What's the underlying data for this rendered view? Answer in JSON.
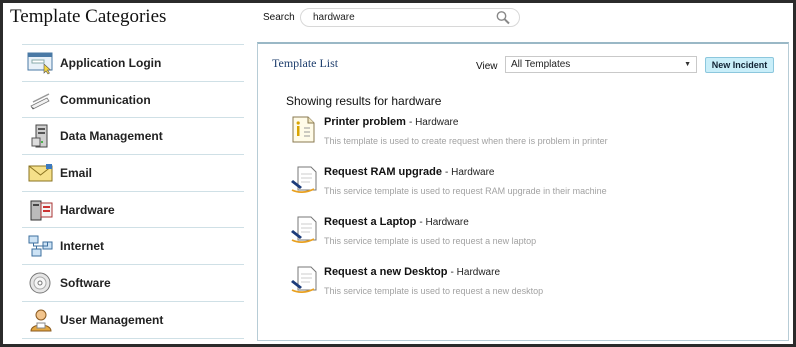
{
  "header": {
    "title": "Template Categories",
    "search_label": "Search",
    "search_value": "hardware"
  },
  "sidebar": {
    "items": [
      {
        "label": "Application Login",
        "icon": "login-window-icon"
      },
      {
        "label": "Communication",
        "icon": "pen-icon"
      },
      {
        "label": "Data Management",
        "icon": "server-icon"
      },
      {
        "label": "Email",
        "icon": "envelope-icon"
      },
      {
        "label": "Hardware",
        "icon": "hardware-icon"
      },
      {
        "label": "Internet",
        "icon": "network-icon"
      },
      {
        "label": "Software",
        "icon": "disc-icon"
      },
      {
        "label": "User Management",
        "icon": "user-icon"
      }
    ]
  },
  "main": {
    "list_title": "Template List",
    "view_label": "View",
    "view_value": "All Templates",
    "new_button": "New Incident",
    "results_heading": "Showing results for hardware",
    "results": [
      {
        "title": "Printer problem",
        "category": "Hardware",
        "description": "This template is used to create request when there is problem in printer",
        "icon": "printer-doc-icon"
      },
      {
        "title": "Request RAM upgrade",
        "category": "Hardware",
        "description": "This service template is used to request RAM upgrade in their machine",
        "icon": "request-doc-icon"
      },
      {
        "title": "Request a Laptop",
        "category": "Hardware",
        "description": "This service template is used to request a new laptop",
        "icon": "request-doc-icon"
      },
      {
        "title": "Request a new Desktop",
        "category": "Hardware",
        "description": "This service template is used to request a new desktop",
        "icon": "request-doc-icon"
      }
    ]
  },
  "colors": {
    "accent_button": "#c9eef9",
    "list_title": "#1f3f6e",
    "divider": "#cfe0e6"
  }
}
